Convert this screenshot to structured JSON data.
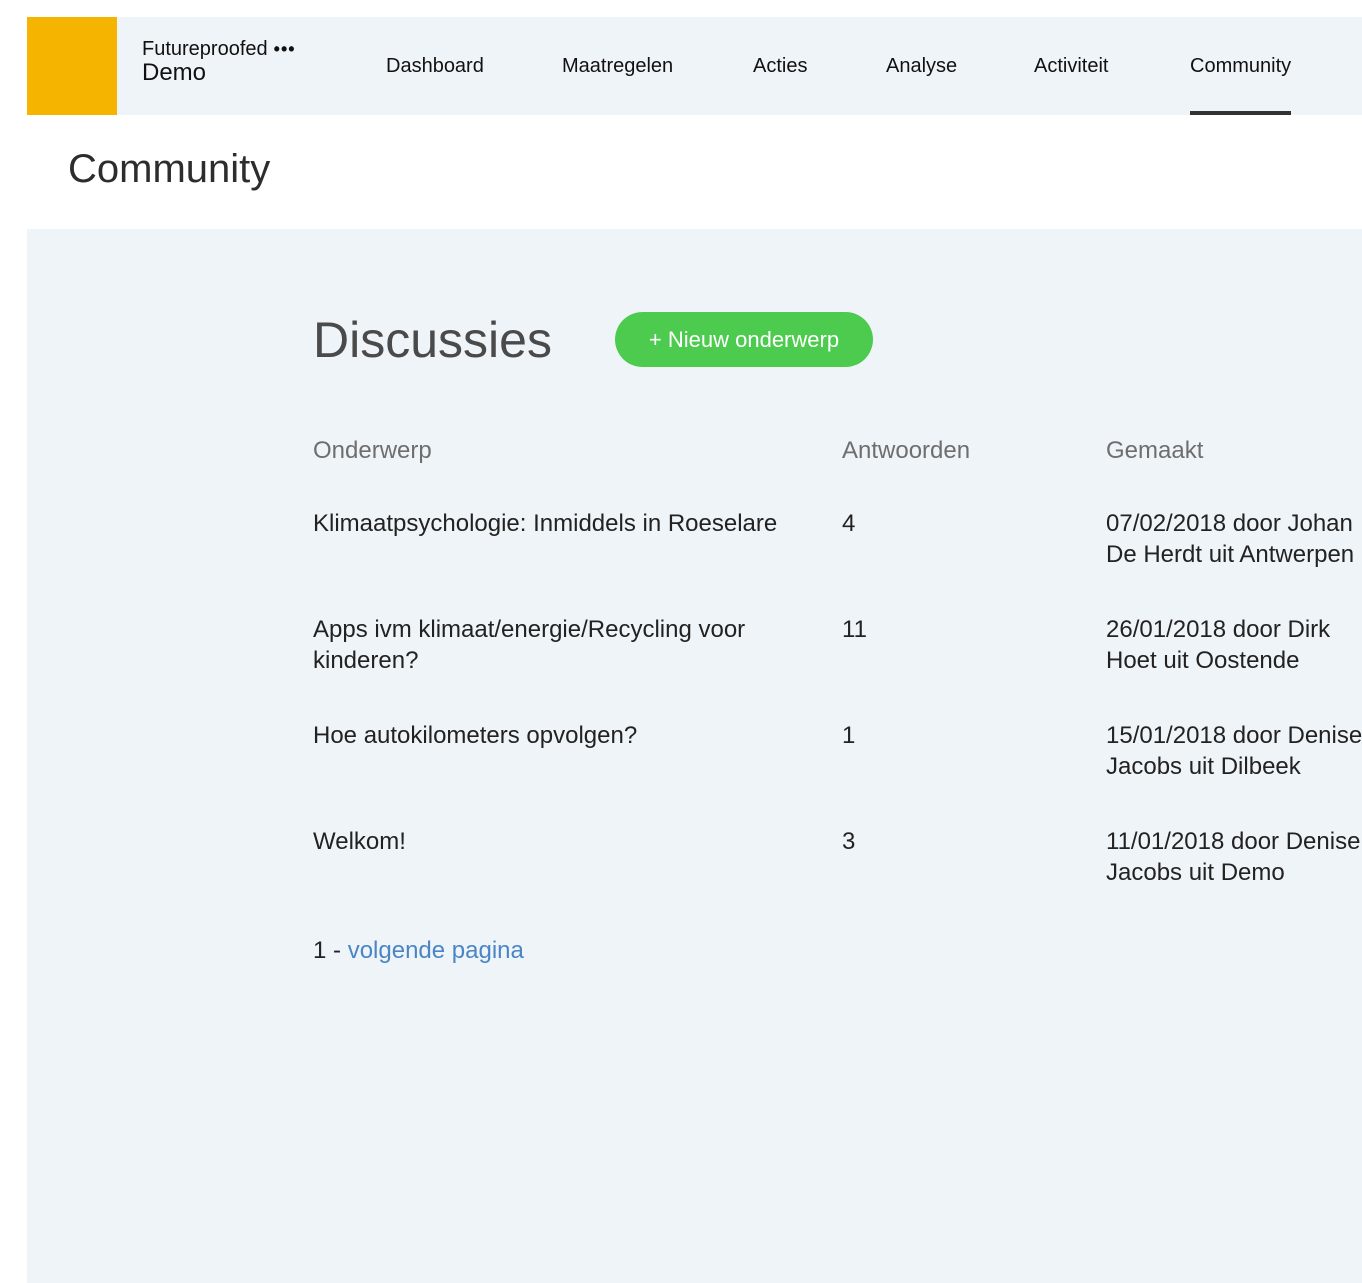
{
  "org": {
    "name": "Futureproofed",
    "menu_glyph": "•••",
    "sub": "Demo",
    "logo_color": "#f5b400"
  },
  "nav": [
    {
      "label": "Dashboard",
      "active": false
    },
    {
      "label": "Maatregelen",
      "active": false
    },
    {
      "label": "Acties",
      "active": false
    },
    {
      "label": "Analyse",
      "active": false
    },
    {
      "label": "Activiteit",
      "active": false
    },
    {
      "label": "Community",
      "active": true
    }
  ],
  "page": {
    "title": "Community"
  },
  "discussions": {
    "title": "Discussies",
    "new_button": "+ Nieuw onderwerp",
    "button_color": "#4dcb4f",
    "columns": [
      "Onderwerp",
      "Antwoorden",
      "Gemaakt"
    ],
    "rows": [
      {
        "subject": "Klimaatpsychologie: Inmiddels in Roeselare",
        "replies": "4",
        "created": "07/02/2018 door Johan De Herdt uit Antwerpen"
      },
      {
        "subject": "Apps ivm klimaat/energie/Recycling voor kinderen?",
        "replies": "11",
        "created": "26/01/2018 door Dirk Hoet uit Oostende"
      },
      {
        "subject": "Hoe autokilometers opvolgen?",
        "replies": "1",
        "created": "15/01/2018 door Denise Jacobs uit Dilbeek"
      },
      {
        "subject": "Welkom!",
        "replies": "3",
        "created": "11/01/2018 door Denise Jacobs uit Demo"
      }
    ]
  },
  "pagination": {
    "current": "1",
    "separator": " - ",
    "next_label": "volgende pagina",
    "link_color": "#4a86c5"
  }
}
